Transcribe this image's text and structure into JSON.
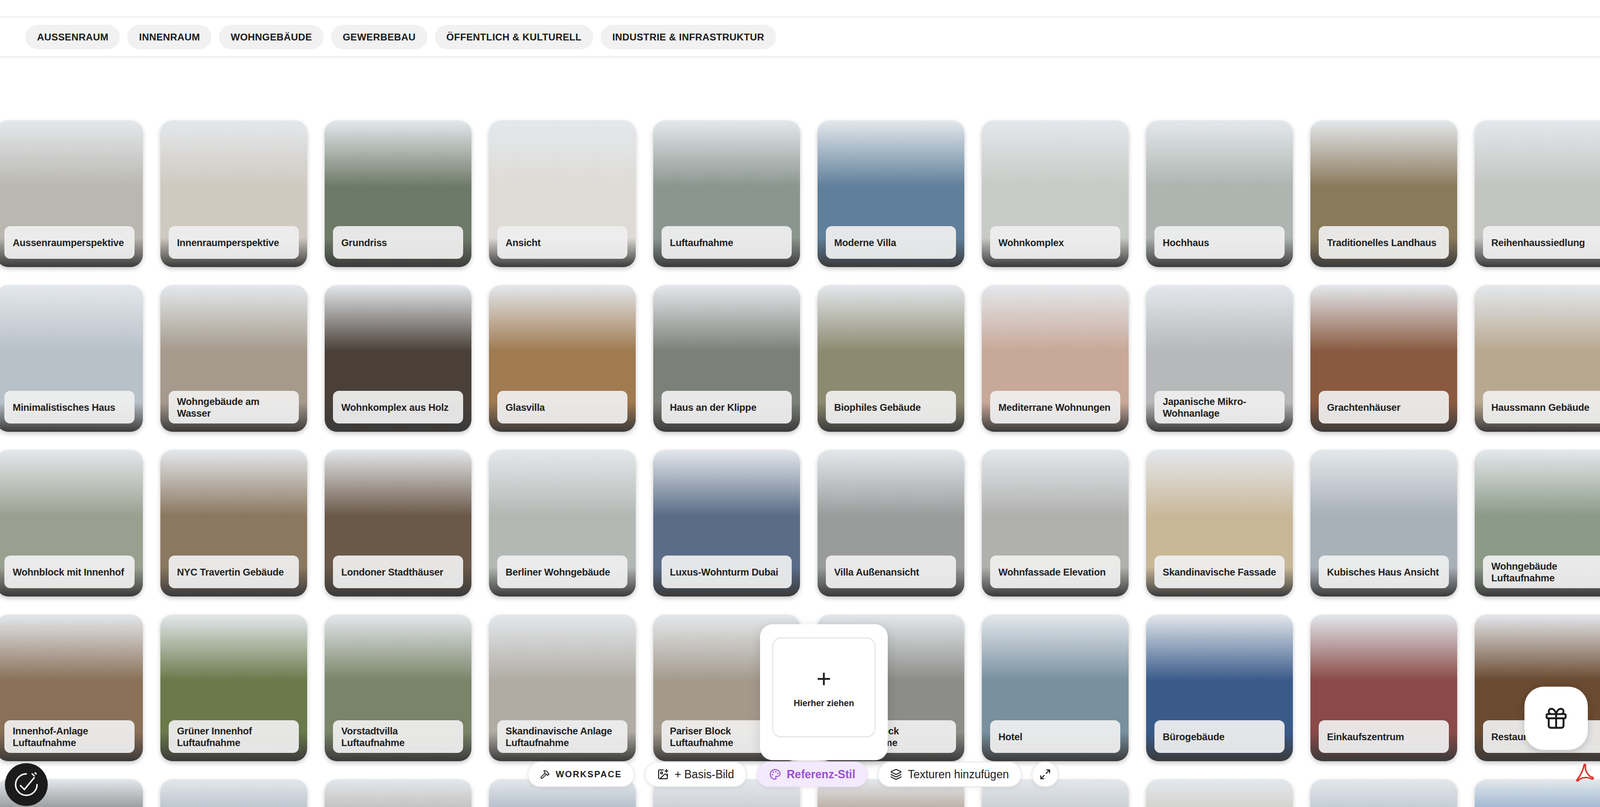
{
  "categories": [
    {
      "label": "AUSSENRAUM",
      "selected": false
    },
    {
      "label": "INNENRAUM",
      "selected": false
    },
    {
      "label": "WOHNGEBÄUDE",
      "selected": false
    },
    {
      "label": "GEWERBEBAU",
      "selected": false
    },
    {
      "label": "ÖFFENTLICH & KULTURELL",
      "selected": false
    },
    {
      "label": "INDUSTRIE & INFRASTRUKTUR",
      "selected": false
    }
  ],
  "gallery": {
    "rows": [
      [
        {
          "label": "Aussenraumperspektive",
          "color": "#b9b7b0"
        },
        {
          "label": "Innenraumperspektive",
          "color": "#cfc9c0"
        },
        {
          "label": "Grundriss",
          "color": "#6e7a68"
        },
        {
          "label": "Ansicht",
          "color": "#dedbd6"
        },
        {
          "label": "Luftaufnahme",
          "color": "#8c9690"
        },
        {
          "label": "Moderne Villa",
          "color": "#5f7f9a"
        },
        {
          "label": "Wohnkomplex",
          "color": "#c8cac6"
        },
        {
          "label": "Hochhaus",
          "color": "#aeb4b0"
        },
        {
          "label": "Traditionelles Landhaus",
          "color": "#8a7a5c"
        },
        {
          "label": "Reihenhaussiedlung",
          "color": "#c2c4c0"
        }
      ],
      [
        {
          "label": "Minimalistisches Haus",
          "color": "#b8c0c8"
        },
        {
          "label": "Wohngebäude am Wasser",
          "color": "#a59a8c"
        },
        {
          "label": "Wohnkomplex aus Holz",
          "color": "#4a4038"
        },
        {
          "label": "Glasvilla",
          "color": "#a07a50"
        },
        {
          "label": "Haus an der Klippe",
          "color": "#7c8078"
        },
        {
          "label": "Biophiles Gebäude",
          "color": "#8c8a70"
        },
        {
          "label": "Mediterrane Wohnungen",
          "color": "#c8a898"
        },
        {
          "label": "Japanische Mikro-Wohnanlage",
          "color": "#b6b8ba"
        },
        {
          "label": "Grachtenhäuser",
          "color": "#8a5a40"
        },
        {
          "label": "Haussmann Gebäude",
          "color": "#b8a890"
        }
      ],
      [
        {
          "label": "Wohnblock mit Innenhof",
          "color": "#9aa090"
        },
        {
          "label": "NYC Travertin Gebäude",
          "color": "#8a7860"
        },
        {
          "label": "Londoner Stadthäuser",
          "color": "#6a5848"
        },
        {
          "label": "Berliner Wohngebäude",
          "color": "#b4b8b4"
        },
        {
          "label": "Luxus-Wohnturm Dubai",
          "color": "#5a6c88"
        },
        {
          "label": "Villa Außenansicht",
          "color": "#9a9c9c"
        },
        {
          "label": "Wohnfassade Elevation",
          "color": "#b0b0ae"
        },
        {
          "label": "Skandinavische Fassade",
          "color": "#c8b898"
        },
        {
          "label": "Kubisches Haus Ansicht",
          "color": "#a8b0b8"
        },
        {
          "label": "Wohngebäude Luftaufnahme",
          "color": "#8c9a88"
        }
      ],
      [
        {
          "label": "Innenhof-Anlage Luftaufnahme",
          "color": "#8a7058"
        },
        {
          "label": "Grüner Innenhof Luftaufnahme",
          "color": "#6a7a4a"
        },
        {
          "label": "Vorstadtvilla Luftaufnahme",
          "color": "#7a8468"
        },
        {
          "label": "Skandinavische Anlage Luftaufnahme",
          "color": "#b0aca4"
        },
        {
          "label": "Pariser Block Luftaufnahme",
          "color": "#a49a8c"
        },
        {
          "label": "Berliner Block Luftaufnahme",
          "color": "#8c8c88"
        },
        {
          "label": "Hotel",
          "color": "#7890a0"
        },
        {
          "label": "Bürogebäude",
          "color": "#3a5a8a"
        },
        {
          "label": "Einkaufszentrum",
          "color": "#8a4a48"
        },
        {
          "label": "Restaurant",
          "color": "#6a4a30"
        }
      ],
      [
        {
          "color": "#3a3a3a"
        },
        {
          "color": "#8a98a8"
        },
        {
          "color": "#9a9088"
        },
        {
          "color": "#7a8ca0"
        },
        {
          "color": "#b0b4b8"
        },
        {
          "color": "#8a6a50"
        },
        {
          "color": "#aab0b4"
        },
        {
          "color": "#c0b8a8"
        },
        {
          "color": "#9aa8b8"
        },
        {
          "color": "#4a7ab0"
        }
      ]
    ]
  },
  "dropzone": {
    "icon": "+",
    "label": "Hierher ziehen"
  },
  "toolbar": [
    {
      "label": "WORKSPACE",
      "kind": "brand",
      "selected": false
    },
    {
      "label": "+ Basis-Bild",
      "kind": "action",
      "selected": false
    },
    {
      "label": "Referenz-Stil",
      "kind": "action",
      "selected": true
    },
    {
      "label": "Texturen hinzufügen",
      "kind": "action",
      "selected": false
    },
    {
      "label": "",
      "kind": "icon",
      "selected": false
    }
  ]
}
